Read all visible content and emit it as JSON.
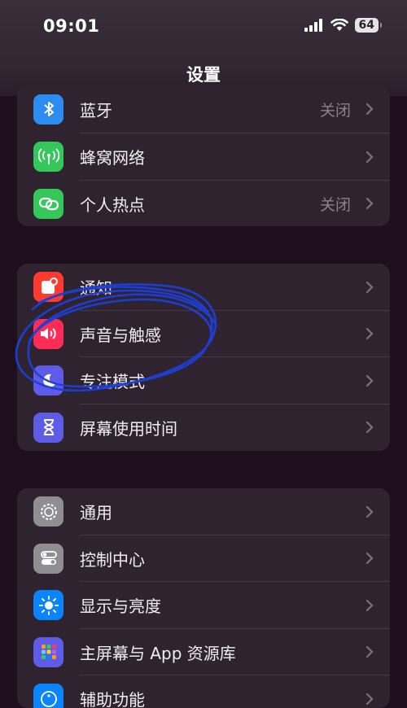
{
  "status_bar": {
    "time": "09:01",
    "battery": "64"
  },
  "nav": {
    "title": "设置"
  },
  "groups": [
    {
      "items": [
        {
          "label": "蓝牙",
          "value": "关闭",
          "icon": "bluetooth-icon",
          "color": "#2d8cf0"
        },
        {
          "label": "蜂窝网络",
          "value": "",
          "icon": "cellular-icon",
          "color": "#34c759"
        },
        {
          "label": "个人热点",
          "value": "关闭",
          "icon": "hotspot-icon",
          "color": "#34c759"
        }
      ]
    },
    {
      "items": [
        {
          "label": "通知",
          "icon": "notification-icon",
          "color": "#ff3b30"
        },
        {
          "label": "声音与触感",
          "icon": "sound-icon",
          "color": "#ff2d55"
        },
        {
          "label": "专注模式",
          "icon": "focus-moon-icon",
          "color": "#5e5ce6"
        },
        {
          "label": "屏幕使用时间",
          "icon": "screen-time-icon",
          "color": "#5e5ce6"
        }
      ]
    },
    {
      "items": [
        {
          "label": "通用",
          "icon": "gear-icon",
          "color": "#8e8e93"
        },
        {
          "label": "控制中心",
          "icon": "control-center-icon",
          "color": "#8e8e93"
        },
        {
          "label": "显示与亮度",
          "icon": "brightness-icon",
          "color": "#0a84ff"
        },
        {
          "label": "主屏幕与 App 资源库",
          "icon": "home-screen-icon",
          "color": "#5e5ce6"
        },
        {
          "label": "辅助功能",
          "icon": "accessibility-icon",
          "color": "#0a84ff"
        }
      ]
    }
  ]
}
